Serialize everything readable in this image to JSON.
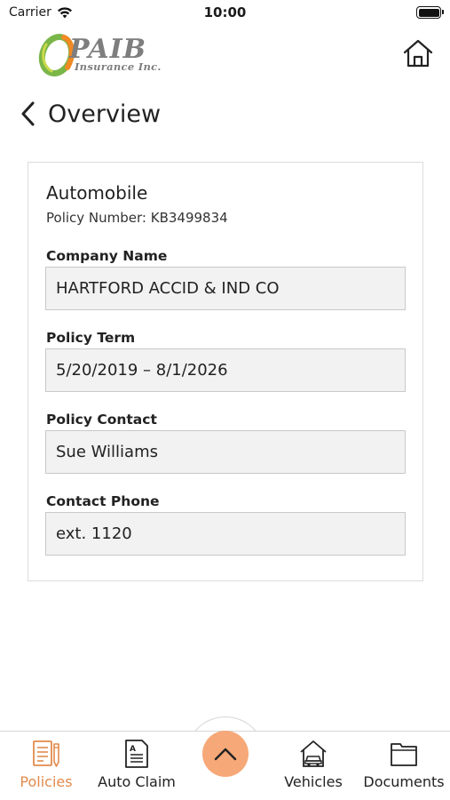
{
  "status_bar": {
    "carrier": "Carrier",
    "time": "10:00"
  },
  "header": {
    "logo_main": "PAIB",
    "logo_sub": "Insurance Inc.",
    "home_icon": "home-icon"
  },
  "page": {
    "title": "Overview",
    "back_icon": "chevron-left-icon"
  },
  "policy": {
    "type": "Automobile",
    "number_line": "Policy Number: KB3499834",
    "fields": [
      {
        "label": "Company Name",
        "value": "HARTFORD ACCID & IND CO"
      },
      {
        "label": "Policy Term",
        "value": "5/20/2019 – 8/1/2026"
      },
      {
        "label": "Policy Contact",
        "value": "Sue Williams"
      },
      {
        "label": "Contact Phone",
        "value": "ext. 1120"
      }
    ]
  },
  "tab_bar": {
    "tabs": [
      {
        "label": "Policies",
        "icon": "policies-icon",
        "active": true
      },
      {
        "label": "Auto Claim",
        "icon": "auto-claim-icon",
        "active": false
      },
      {
        "label": "Vehicles",
        "icon": "vehicles-icon",
        "active": false
      },
      {
        "label": "Documents",
        "icon": "documents-icon",
        "active": false
      }
    ],
    "center_icon": "chevron-up-icon"
  },
  "colors": {
    "accent": "#e38b4c",
    "center_button": "#f6a878",
    "field_bg": "#f2f2f2",
    "logo_green": "#7ab648",
    "logo_orange": "#f08a24"
  }
}
